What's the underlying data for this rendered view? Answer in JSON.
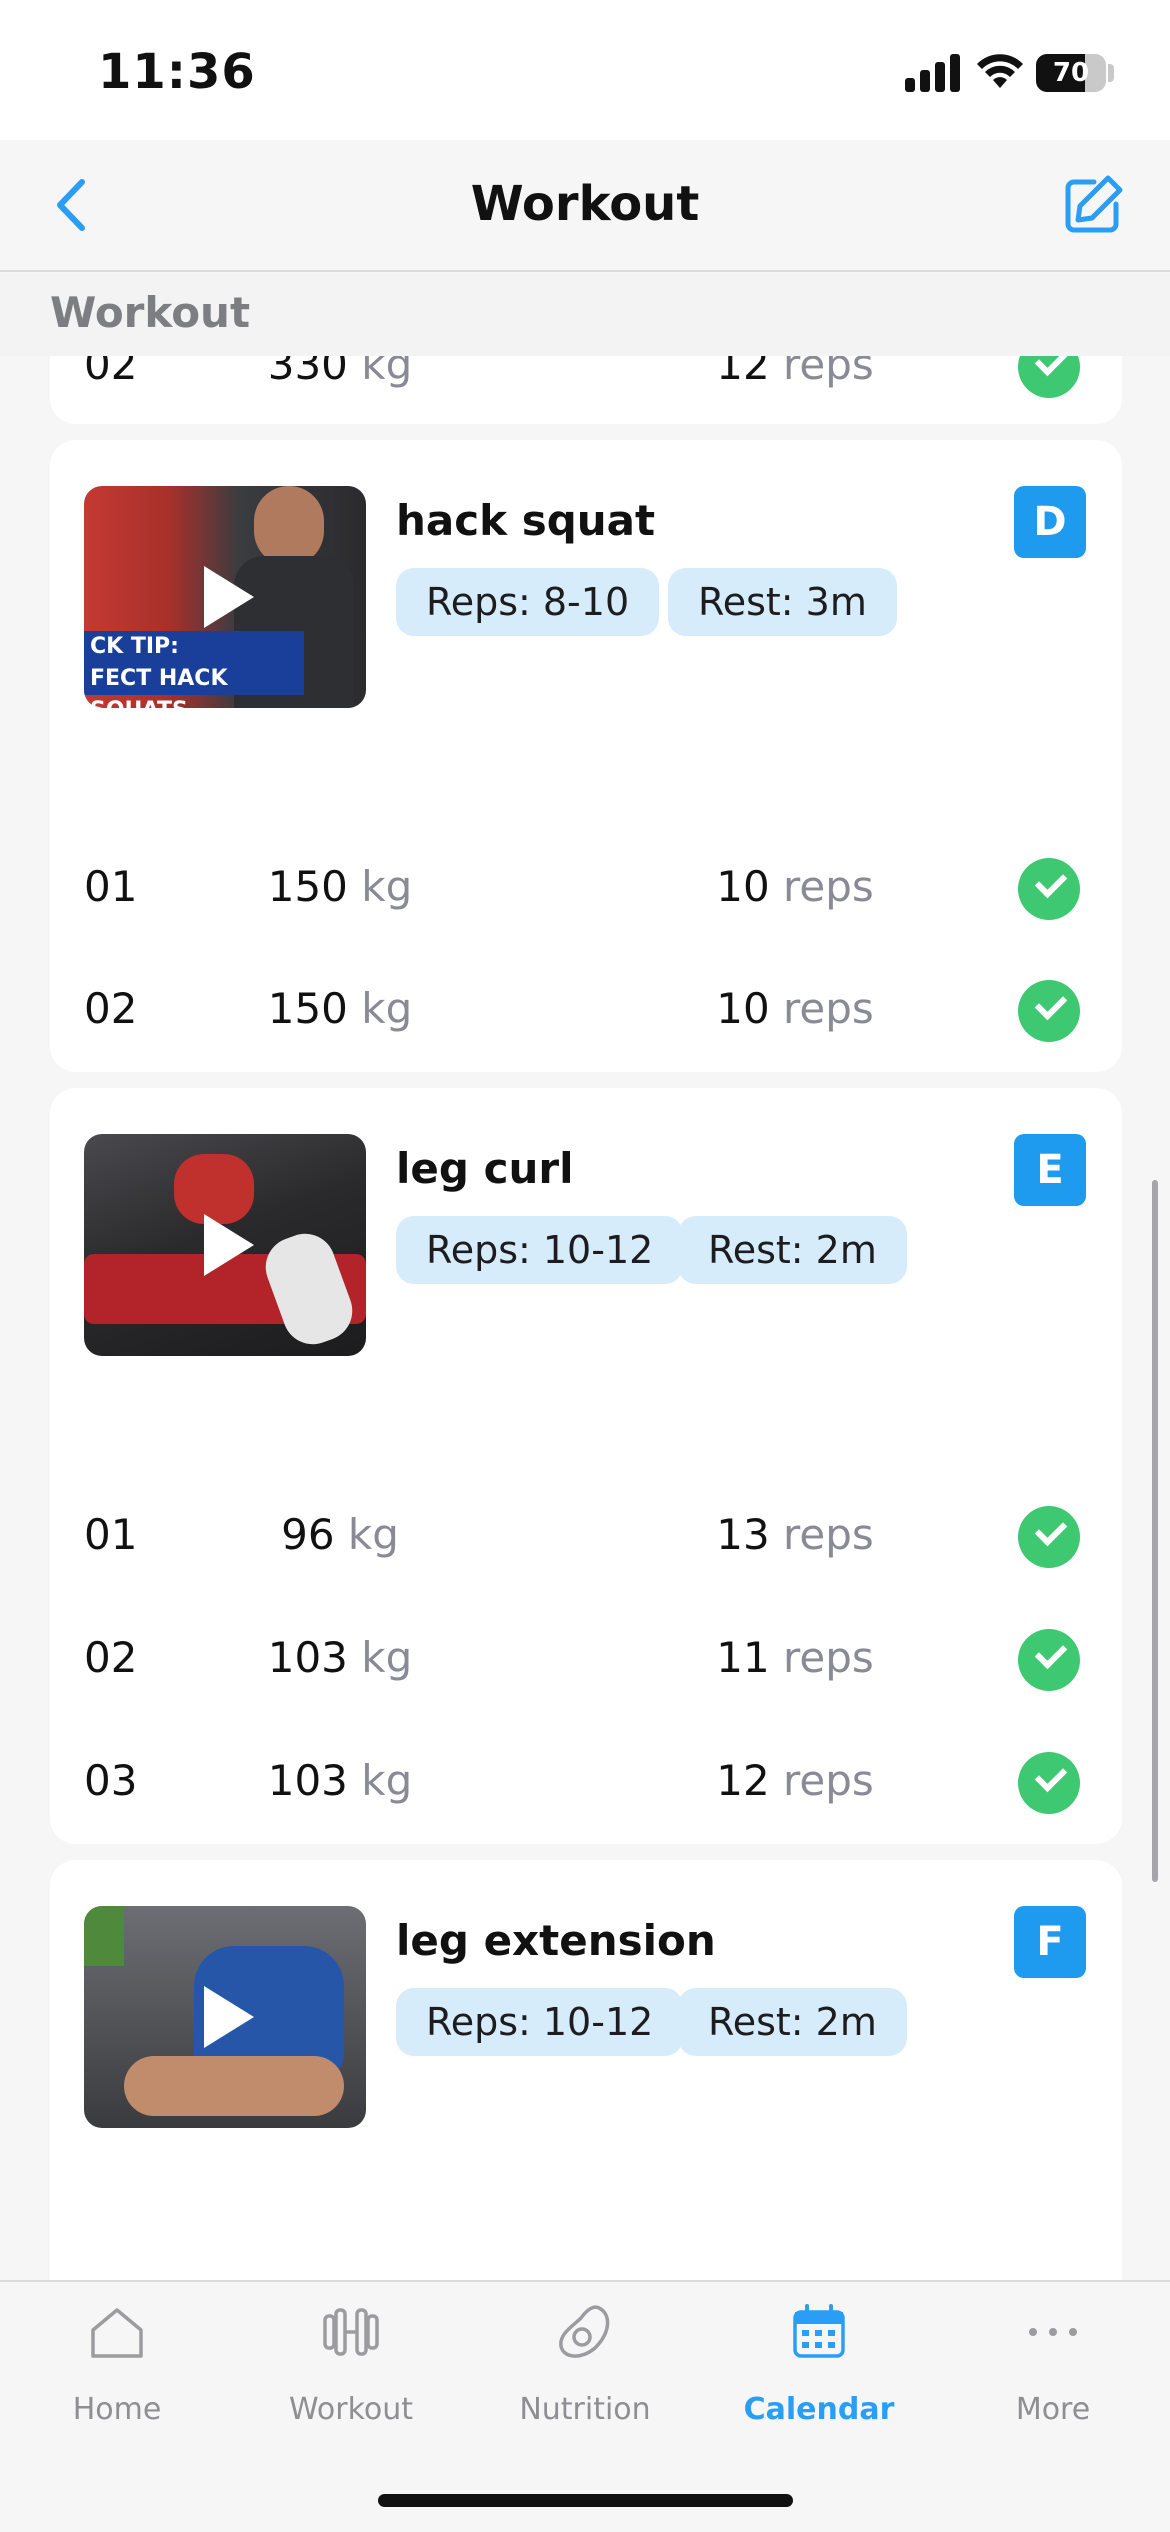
{
  "status_bar": {
    "time": "11:36",
    "battery": "70",
    "battery_level": 0.7
  },
  "nav": {
    "title": "Workout"
  },
  "section_header": "Workout",
  "partial_row": {
    "set": "02",
    "weight": "330",
    "weight_unit": "kg",
    "reps": "12",
    "reps_unit": "reps"
  },
  "exercises": [
    {
      "name": "hack squat",
      "badge": "D",
      "reps_chip": "Reps: 8-10",
      "rest_chip": "Rest: 3m",
      "video_caption_1": "CK TIP:",
      "video_caption_2": "FECT HACK SQUATS",
      "sets": [
        {
          "set": "01",
          "weight": "150",
          "weight_unit": "kg",
          "reps": "10",
          "reps_unit": "reps",
          "done": true
        },
        {
          "set": "02",
          "weight": "150",
          "weight_unit": "kg",
          "reps": "10",
          "reps_unit": "reps",
          "done": true
        }
      ]
    },
    {
      "name": "leg curl",
      "badge": "E",
      "reps_chip": "Reps: 10-12",
      "rest_chip": "Rest: 2m",
      "sets": [
        {
          "set": "01",
          "weight": "96",
          "weight_unit": "kg",
          "reps": "13",
          "reps_unit": "reps",
          "done": true
        },
        {
          "set": "02",
          "weight": "103",
          "weight_unit": "kg",
          "reps": "11",
          "reps_unit": "reps",
          "done": true
        },
        {
          "set": "03",
          "weight": "103",
          "weight_unit": "kg",
          "reps": "12",
          "reps_unit": "reps",
          "done": true
        }
      ]
    },
    {
      "name": "leg extension",
      "badge": "F",
      "reps_chip": "Reps: 10-12",
      "rest_chip": "Rest: 2m",
      "sets": []
    }
  ],
  "tabs": [
    {
      "label": "Home",
      "icon": "home-icon",
      "active": false
    },
    {
      "label": "Workout",
      "icon": "dumbbell-icon",
      "active": false
    },
    {
      "label": "Nutrition",
      "icon": "avocado-icon",
      "active": false
    },
    {
      "label": "Calendar",
      "icon": "calendar-icon",
      "active": true
    },
    {
      "label": "More",
      "icon": "more-icon",
      "active": false
    }
  ],
  "colors": {
    "accent": "#2a9df4",
    "badge": "#1e9aee",
    "chip": "#d6ecfb",
    "check": "#3fc872",
    "muted_unit": "#8a8a96"
  }
}
